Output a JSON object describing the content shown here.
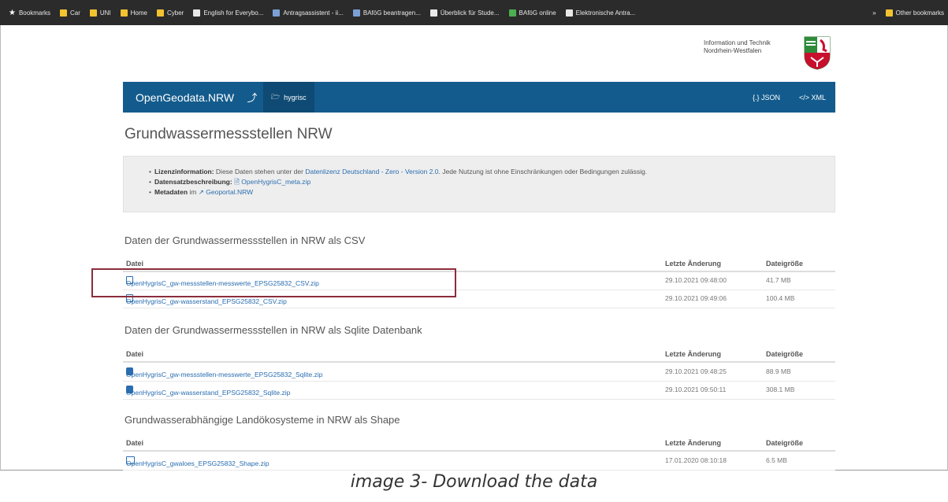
{
  "bookmarks_bar": {
    "items": [
      {
        "label": "Bookmarks",
        "icon": "star-icon"
      },
      {
        "label": "Car",
        "icon": "folder-icon"
      },
      {
        "label": "UNI",
        "icon": "folder-icon"
      },
      {
        "label": "Home",
        "icon": "folder-icon"
      },
      {
        "label": "Cyber",
        "icon": "folder-icon"
      },
      {
        "label": "English for Everybo...",
        "icon": "site-icon"
      },
      {
        "label": "Antragsassistent - ii...",
        "icon": "site-icon"
      },
      {
        "label": "BAföG beantragen...",
        "icon": "site-icon"
      },
      {
        "label": "Überblick für Stude...",
        "icon": "site-icon"
      },
      {
        "label": "BAföG online",
        "icon": "site-icon"
      },
      {
        "label": "Elektronische Antra...",
        "icon": "site-icon"
      }
    ],
    "other": "Other bookmarks"
  },
  "header": {
    "org_line1": "Information und Technik",
    "org_line2": "Nordrhein-Westfalen",
    "crest_icon": "nrw-crest-icon"
  },
  "navbar": {
    "brand": "OpenGeodata.NRW",
    "crumb": "hygrisc",
    "json_link": "{.} JSON",
    "xml_link": "</> XML",
    "bg_color": "#135b8c"
  },
  "page_title": "Grundwassermessstellen NRW",
  "info": {
    "license_label": "Lizenzinformation:",
    "license_text_1": "Diese Daten stehen unter der",
    "license_link": "Datenlizenz Deutschland - Zero - Version 2.0",
    "license_text_2": ". Jede Nutzung ist ohne Einschränkungen oder Bedingungen zulässig.",
    "desc_label": "Datensatzbeschreibung:",
    "desc_link": "OpenHygrisC_meta.zip",
    "meta_label": "Metadaten",
    "meta_text": "im",
    "meta_link": "Geoportal.NRW"
  },
  "columns": {
    "file": "Datei",
    "modified": "Letzte Änderung",
    "size": "Dateigröße"
  },
  "sections": [
    {
      "title": "Daten der Grundwassermessstellen in NRW als CSV",
      "rows": [
        {
          "file": "OpenHygrisC_gw-messstellen-messwerte_EPSG25832_CSV.zip",
          "modified": "29.10.2021 09:48:00",
          "size": "41.7 MB"
        },
        {
          "file": "OpenHygrisC_gw-wasserstand_EPSG25832_CSV.zip",
          "modified": "29.10.2021 09:49:06",
          "size": "100.4 MB"
        }
      ]
    },
    {
      "title": "Daten der Grundwassermessstellen in NRW als Sqlite Datenbank",
      "rows": [
        {
          "file": "OpenHygrisC_gw-messstellen-messwerte_EPSG25832_Sqlite.zip",
          "modified": "29.10.2021 09:48:25",
          "size": "88.9 MB"
        },
        {
          "file": "OpenHygrisC_gw-wasserstand_EPSG25832_Sqlite.zip",
          "modified": "29.10.2021 09:50:11",
          "size": "308.1 MB"
        }
      ]
    },
    {
      "title": "Grundwasserabhängige Landökosysteme in NRW als Shape",
      "rows": [
        {
          "file": "OpenHygrisC_gwaloes_EPSG25832_Shape.zip",
          "modified": "17.01.2020 08:10:18",
          "size": "6.5 MB"
        }
      ]
    }
  ],
  "caption": "image 3- Download the data"
}
